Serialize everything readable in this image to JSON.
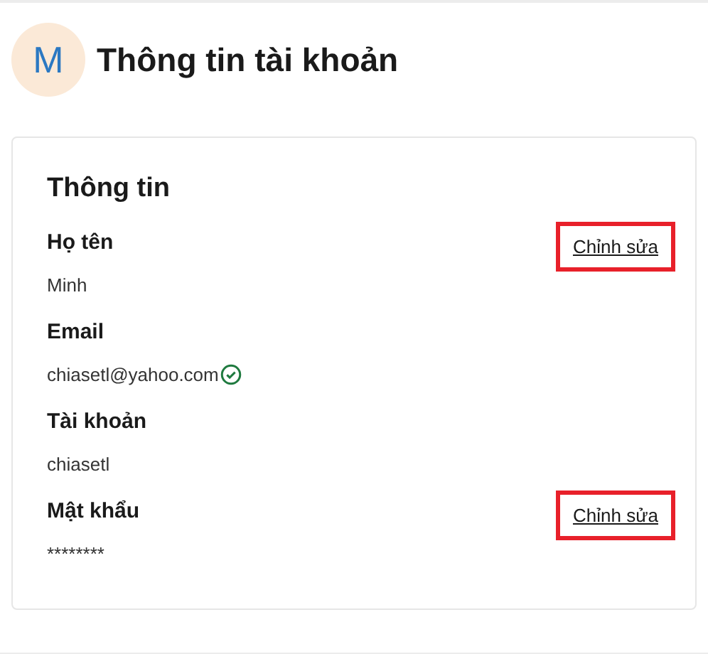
{
  "header": {
    "avatar": "M",
    "title": "Thông tin tài khoản"
  },
  "card": {
    "title": "Thông tin",
    "fields": [
      {
        "label": "Họ tên",
        "value": "Minh",
        "verified": false,
        "edit": {
          "label": "Chỉnh sửa",
          "highlighted": true
        }
      },
      {
        "label": "Email",
        "value": "chiasetl@yahoo.com",
        "verified": true
      },
      {
        "label": "Tài khoản",
        "value": "chiasetl",
        "verified": false
      },
      {
        "label": "Mật khẩu",
        "value": "********",
        "verified": false,
        "edit": {
          "label": "Chỉnh sửa",
          "highlighted": true
        }
      }
    ]
  }
}
